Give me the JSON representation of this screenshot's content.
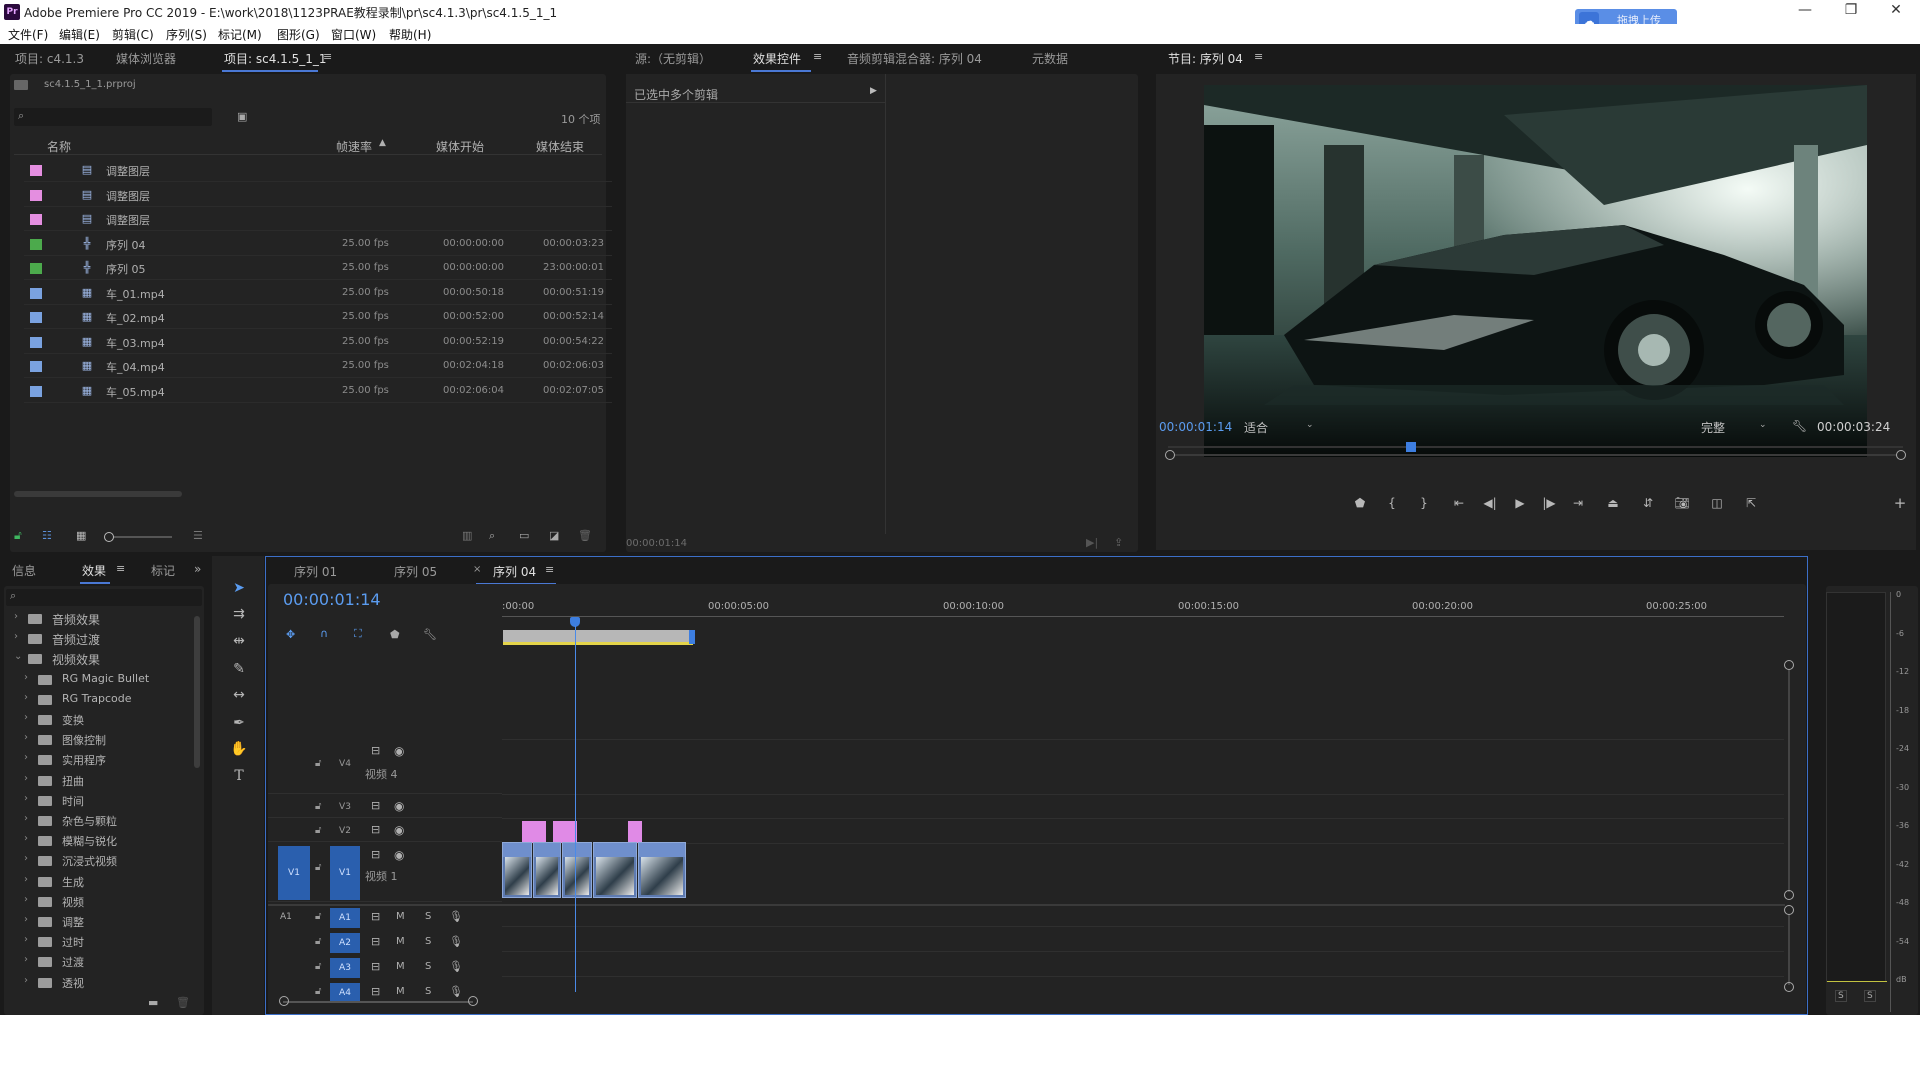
{
  "title_bar": {
    "app_icon": "Pr",
    "title": "Adobe Premiere Pro CC 2019 - E:\\work\\2018\\1123PRAE教程录制\\pr\\sc4.1.3\\pr\\sc4.1.5_1_1",
    "upload_label": "拖拽上传",
    "upload_icon": "cloud-icon"
  },
  "menubar": {
    "items": [
      "文件(F)",
      "编辑(E)",
      "剪辑(C)",
      "序列(S)",
      "标记(M)",
      "图形(G)",
      "窗口(W)",
      "帮助(H)"
    ]
  },
  "project_panel": {
    "tabs": [
      "项目: c4.1.3",
      "媒体浏览器",
      "项目: sc4.1.5_1_1"
    ],
    "project_file": "sc4.1.5_1_1.prproj",
    "search_placeholder": "",
    "item_count": "10 个项",
    "columns": [
      "名称",
      "帧速率",
      "媒体开始",
      "媒体结束"
    ],
    "rows": [
      {
        "color": "#e48ee0",
        "icon": "adjustment-layer-icon",
        "name": "调整图层",
        "fps": "",
        "start": "",
        "end": ""
      },
      {
        "color": "#e48ee0",
        "icon": "adjustment-layer-icon",
        "name": "调整图层",
        "fps": "",
        "start": "",
        "end": ""
      },
      {
        "color": "#e48ee0",
        "icon": "adjustment-layer-icon",
        "name": "调整图层",
        "fps": "",
        "start": "",
        "end": ""
      },
      {
        "color": "#4caa4c",
        "icon": "sequence-icon",
        "name": "序列 04",
        "fps": "25.00 fps",
        "start": "00:00:00:00",
        "end": "00:00:03:23"
      },
      {
        "color": "#4caa4c",
        "icon": "sequence-icon",
        "name": "序列 05",
        "fps": "25.00 fps",
        "start": "00:00:00:00",
        "end": "23:00:00:01"
      },
      {
        "color": "#7aa2e0",
        "icon": "video-clip-icon",
        "name": "车_01.mp4",
        "fps": "25.00 fps",
        "start": "00:00:50:18",
        "end": "00:00:51:19"
      },
      {
        "color": "#7aa2e0",
        "icon": "video-clip-icon",
        "name": "车_02.mp4",
        "fps": "25.00 fps",
        "start": "00:00:52:00",
        "end": "00:00:52:14"
      },
      {
        "color": "#7aa2e0",
        "icon": "video-clip-icon",
        "name": "车_03.mp4",
        "fps": "25.00 fps",
        "start": "00:00:52:19",
        "end": "00:00:54:22"
      },
      {
        "color": "#7aa2e0",
        "icon": "video-clip-icon",
        "name": "车_04.mp4",
        "fps": "25.00 fps",
        "start": "00:02:04:18",
        "end": "00:02:06:03"
      },
      {
        "color": "#7aa2e0",
        "icon": "video-clip-icon",
        "name": "车_05.mp4",
        "fps": "25.00 fps",
        "start": "00:02:06:04",
        "end": "00:02:07:05"
      }
    ]
  },
  "effect_controls": {
    "tabs": [
      "源:（无剪辑）",
      "效果控件",
      "音频剪辑混合器: 序列 04",
      "元数据"
    ],
    "message": "已选中多个剪辑",
    "timecode": "00:00:01:14"
  },
  "program_monitor": {
    "title": "节目: 序列 04",
    "timecode": "00:00:01:14",
    "fit": "适合",
    "quality": "完整",
    "duration": "00:00:03:24",
    "playhead_fraction": 0.33
  },
  "effects_panel": {
    "tabs": [
      "信息",
      "效果",
      "标记"
    ],
    "tree": [
      {
        "label": "音频效果",
        "level": 0,
        "open": false
      },
      {
        "label": "音频过渡",
        "level": 0,
        "open": false
      },
      {
        "label": "视频效果",
        "level": 0,
        "open": true
      },
      {
        "label": "RG Magic Bullet",
        "level": 1,
        "open": false
      },
      {
        "label": "RG Trapcode",
        "level": 1,
        "open": false
      },
      {
        "label": "变换",
        "level": 1,
        "open": false
      },
      {
        "label": "图像控制",
        "level": 1,
        "open": false
      },
      {
        "label": "实用程序",
        "level": 1,
        "open": false
      },
      {
        "label": "扭曲",
        "level": 1,
        "open": false
      },
      {
        "label": "时间",
        "level": 1,
        "open": false
      },
      {
        "label": "杂色与颗粒",
        "level": 1,
        "open": false
      },
      {
        "label": "模糊与锐化",
        "level": 1,
        "open": false
      },
      {
        "label": "沉浸式视频",
        "level": 1,
        "open": false
      },
      {
        "label": "生成",
        "level": 1,
        "open": false
      },
      {
        "label": "视频",
        "level": 1,
        "open": false
      },
      {
        "label": "调整",
        "level": 1,
        "open": false
      },
      {
        "label": "过时",
        "level": 1,
        "open": false
      },
      {
        "label": "过渡",
        "level": 1,
        "open": false
      },
      {
        "label": "透视",
        "level": 1,
        "open": false
      }
    ]
  },
  "timeline": {
    "tabs": [
      "序列 01",
      "序列 05",
      "序列 04"
    ],
    "timecode": "00:00:01:14",
    "ruler": [
      ":00:00",
      "00:00:05:00",
      "00:00:10:00",
      "00:00:15:00",
      "00:00:20:00",
      "00:00:25:00"
    ],
    "video_tracks": [
      {
        "id": "V4",
        "name": "视频 4"
      },
      {
        "id": "V3",
        "name": ""
      },
      {
        "id": "V2",
        "name": ""
      },
      {
        "id": "V1",
        "name": "视频 1",
        "source": "V1"
      }
    ],
    "audio_tracks": [
      {
        "id": "A1",
        "source": "A1",
        "m": "M",
        "s": "S"
      },
      {
        "id": "A2",
        "source": "",
        "m": "M",
        "s": "S"
      },
      {
        "id": "A3",
        "source": "",
        "m": "M",
        "s": "S"
      },
      {
        "id": "A4",
        "source": "",
        "m": "M",
        "s": "S"
      }
    ]
  },
  "audio_meter": {
    "labels": [
      "0",
      "-6",
      "-12",
      "-18",
      "-24",
      "-30",
      "-36",
      "-42",
      "-48",
      "-54",
      "dB"
    ],
    "solo": [
      "S",
      "S"
    ]
  },
  "colors": {
    "accent": "#4a78d4",
    "timecode": "#5b9cf0",
    "adjustment": "#e08ae6",
    "video": "#7aa2e0",
    "sequence": "#4caa4c"
  }
}
